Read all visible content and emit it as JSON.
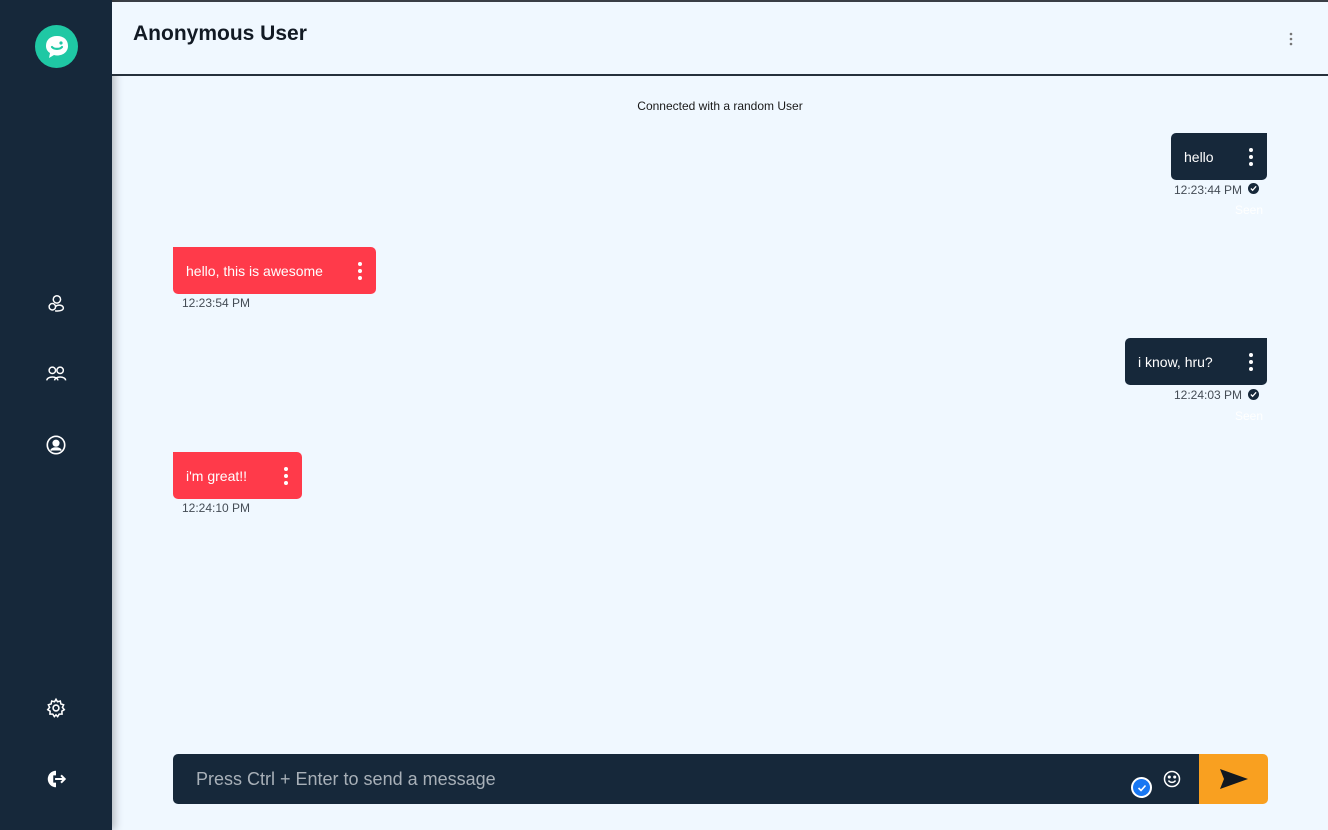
{
  "header": {
    "title": "Anonymous User"
  },
  "chat": {
    "status": "Connected with a random User",
    "messages": [
      {
        "direction": "sent",
        "text": "hello",
        "time": "12:23:44 PM",
        "seen": "Seen"
      },
      {
        "direction": "received",
        "text": "hello, this is awesome",
        "time": "12:23:54 PM"
      },
      {
        "direction": "sent",
        "text": "i know, hru?",
        "time": "12:24:03 PM",
        "seen": "Seen"
      },
      {
        "direction": "received",
        "text": "i'm great!!",
        "time": "12:24:10 PM"
      }
    ]
  },
  "composer": {
    "placeholder": "Press Ctrl + Enter to send a message"
  },
  "icons": {
    "logo": "chat-bubble-logo",
    "nav": [
      "user-icon",
      "users-icon",
      "profile-icon"
    ],
    "bottom": [
      "gear-icon",
      "logout-icon"
    ],
    "send": "send-icon",
    "emoji": "smiley-icon"
  },
  "colors": {
    "sidebar": "#16283a",
    "logo": "#1fc8a4",
    "sent_bubble": "#16283a",
    "received_bubble": "#ff3a4a",
    "send_button": "#f9a020",
    "background": "#f0f8ff"
  }
}
